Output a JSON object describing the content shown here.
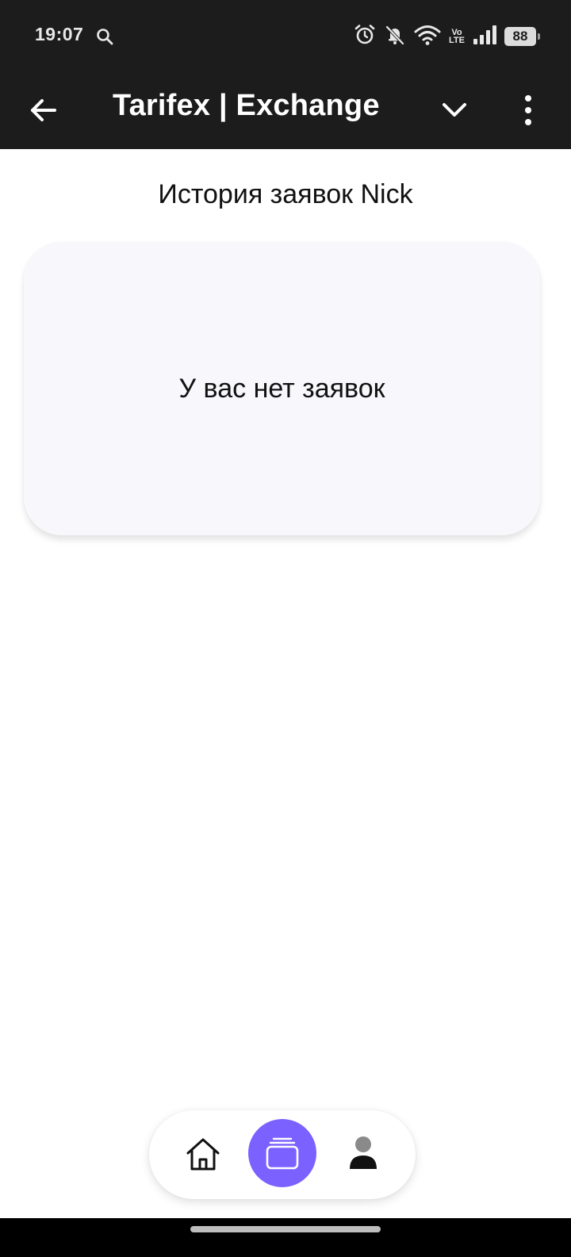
{
  "status_bar": {
    "time": "19:07",
    "battery": "88",
    "network_label_top": "Vo",
    "network_label_bottom": "LTE",
    "icons": [
      "search-icon",
      "alarm-icon",
      "bell-off-icon",
      "wifi-icon",
      "signal-icon",
      "battery-icon"
    ]
  },
  "app_bar": {
    "title": "Tarifex | Exchange",
    "icons": [
      "back-arrow-icon",
      "chevron-down-icon",
      "more-vertical-icon"
    ]
  },
  "main": {
    "title": "История заявок Nick",
    "empty_message": "У вас нет заявок"
  },
  "bottom_nav": {
    "items": [
      {
        "icon": "home-icon",
        "active": false
      },
      {
        "icon": "orders-icon",
        "active": true
      },
      {
        "icon": "profile-icon",
        "active": false
      }
    ],
    "accent_color": "#7b61ff"
  },
  "colors": {
    "top_bar": "#1c1c1c",
    "card_background": "#f8f8fc"
  }
}
